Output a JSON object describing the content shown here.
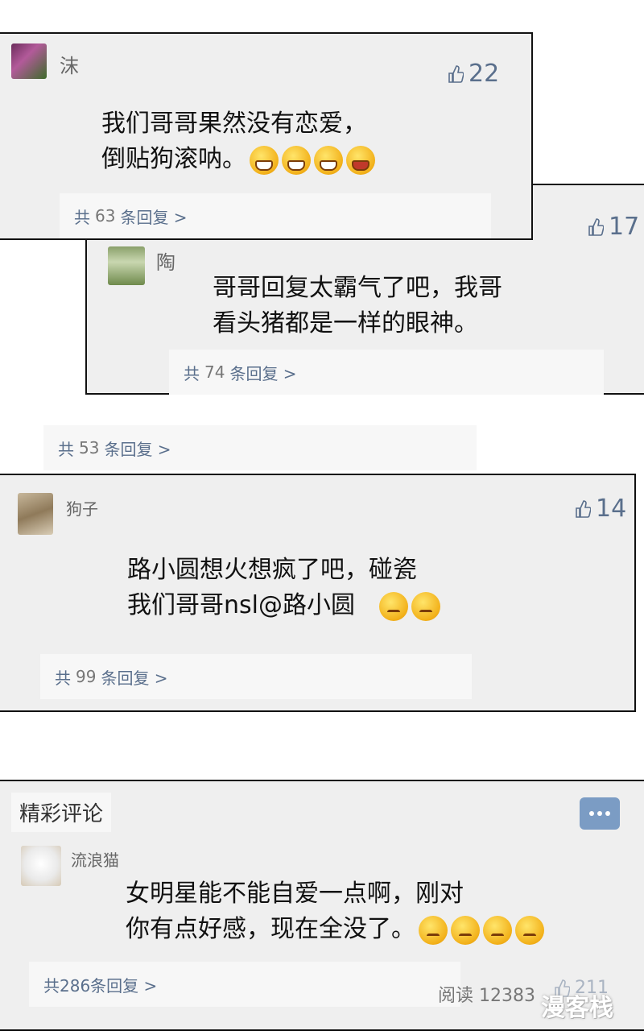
{
  "comments": [
    {
      "user": "沫",
      "likes": "22",
      "line1": "我们哥哥果然没有恋爱，",
      "line2": "倒贴狗滚呐。",
      "reply_prefix": "共",
      "reply_count": "63",
      "reply_suffix": "条回复 >"
    },
    {
      "user": "陶",
      "likes": "17",
      "line1": "哥哥回复太霸气了吧，我哥",
      "line2": "看头猪都是一样的眼神。",
      "reply_prefix": "共",
      "reply_count": "74",
      "reply_suffix": "条回复 >"
    },
    {
      "reply_prefix": "共",
      "reply_count": "53",
      "reply_suffix": "条回复 >"
    },
    {
      "user": "狗子",
      "likes": "14",
      "line1": "路小圆想火想疯了吧，碰瓷",
      "line2": "我们哥哥nsl@路小圆",
      "reply_prefix": "共",
      "reply_count": "99",
      "reply_suffix": "条回复 >"
    }
  ],
  "featured": {
    "title": "精彩评论",
    "user": "流浪猫",
    "line1": "女明星能不能自爱一点啊，刚对",
    "line2": "你有点好感，现在全没了。",
    "reply": "共286条回复 >",
    "reads": "阅读 12383",
    "likes": "211",
    "watermark": "漫客栈"
  },
  "colors": {
    "link": "#5a6f8c",
    "panel": "#efefef",
    "border": "#111111"
  }
}
